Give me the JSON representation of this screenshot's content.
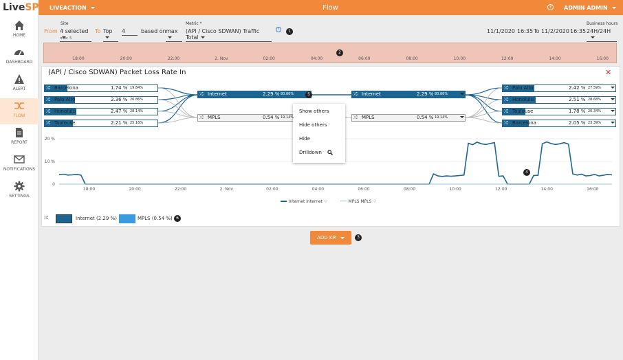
{
  "app": {
    "logo_a": "Live",
    "logo_b": "SP",
    "title": "Flow",
    "project": "LIVEACTION",
    "user": "ADMIN ADMIN"
  },
  "sidebar": {
    "items": [
      {
        "label": "HOME",
        "icon": "home-icon"
      },
      {
        "label": "DASHBOARD",
        "icon": "speedometer-icon"
      },
      {
        "label": "ALERT",
        "icon": "warning-icon"
      },
      {
        "label": "FLOW",
        "icon": "flow-icon"
      },
      {
        "label": "REPORT",
        "icon": "document-icon"
      },
      {
        "label": "NOTIFICATIONS",
        "icon": "mail-icon"
      },
      {
        "label": "SETTINGS",
        "icon": "gear-icon"
      }
    ],
    "active": "FLOW"
  },
  "filters": {
    "site_label": "Site",
    "from_label": "From",
    "site_value": "4 selected",
    "max_hint": "max: 5",
    "to_label": "To",
    "top_value": "Top",
    "top_count": "4",
    "based_on_label": "based on",
    "based_on_value": "max",
    "metric_label": "Metric *",
    "metric_value": "(API / Cisco SDWAN) Traffic Total",
    "date_from": "11/1/2020",
    "time_from": "16:35",
    "date_to_label": "To 11/2/2020",
    "time_to": "16:35",
    "business_hours_label": "Business hours",
    "business_hours_value": "24H/24H",
    "callout_1": "1",
    "callout_2": "2",
    "callout_3": "3",
    "callout_4": "4",
    "callout_5": "5",
    "callout_6": "6"
  },
  "timeline": {
    "ticks": [
      "18:00",
      "20:00",
      "22:00",
      "2. Nov",
      "02:00",
      "04:00",
      "06:00",
      "08:00",
      "10:00",
      "12:00",
      "14:00",
      "16:00"
    ]
  },
  "panel": {
    "title": "(API / Cisco SDWAN) Packet Loss Rate In",
    "left_sites": [
      {
        "name": "Barcelona",
        "pct": "1.74 %",
        "share": "19.84%",
        "fill": 0.2
      },
      {
        "name": "Palo Alto",
        "pct": "2.36 %",
        "share": "26.86%",
        "fill": 0.27
      },
      {
        "name": "Honolulu",
        "pct": "2.47 %",
        "share": "28.14%",
        "fill": 0.28
      },
      {
        "name": "Toulouse",
        "pct": "2.21 %",
        "share": "25.16%",
        "fill": 0.25
      }
    ],
    "mid_left": [
      {
        "name": "Internet",
        "pct": "2.29 %",
        "share": "80.86%"
      },
      {
        "name": "MPLS",
        "pct": "0.54 %",
        "share": "19.14%"
      }
    ],
    "mid_right": [
      {
        "name": "Internet",
        "pct": "2.29 %",
        "share": "80.86%"
      },
      {
        "name": "MPLS",
        "pct": "0.54 %",
        "share": "19.14%"
      }
    ],
    "right_sites": [
      {
        "name": "Palo Alto",
        "pct": "2.42 %",
        "share": "27.59%",
        "fill": 0.28
      },
      {
        "name": "Honolulu",
        "pct": "2.51 %",
        "share": "28.68%",
        "fill": 0.29
      },
      {
        "name": "Toulouse",
        "pct": "1.78 %",
        "share": "20.34%",
        "fill": 0.2
      },
      {
        "name": "Barcelona",
        "pct": "2.05 %",
        "share": "23.39%",
        "fill": 0.23
      }
    ],
    "context_menu": [
      "Show others",
      "Hide others",
      "Hide",
      "Drilldown"
    ],
    "legend_bottom": [
      {
        "label": "Internet (2.29 %)",
        "color": "#1d6591"
      },
      {
        "label": "MPLS (0.54 %)",
        "color": "#3a9be0"
      }
    ],
    "chart_legend": [
      "Internet Internet",
      "MPLS MPLS"
    ]
  },
  "chart_data": {
    "type": "line",
    "y_ticks": [
      "20 %",
      "10 %",
      "0"
    ],
    "ylim": [
      0,
      20
    ],
    "x_ticks": [
      "18:00",
      "20:00",
      "22:00",
      "2. Nov",
      "02:00",
      "04:00",
      "06:00",
      "08:00",
      "10:00",
      "12:00",
      "14:00",
      "16:00"
    ],
    "series": [
      {
        "name": "Internet Internet",
        "color": "#1d6591",
        "x": [
          0,
          0.2,
          0.4,
          0.6,
          0.8,
          1,
          1.2,
          1.5,
          2,
          4,
          6,
          8,
          10,
          12,
          14,
          16,
          17,
          17.2,
          17.4,
          17.6,
          17.8,
          18,
          18.2,
          18.4,
          18.6,
          18.8,
          19,
          19.2,
          19.4,
          19.6,
          19.8,
          20,
          20.2,
          20.4,
          20.6,
          20.8,
          21,
          21.2,
          21.4,
          21.6,
          21.8,
          22,
          22.2,
          22.4,
          22.6,
          22.8,
          23,
          23.2,
          23.4,
          23.6,
          23.8,
          24,
          24.2,
          24.4,
          24.6,
          24.8,
          25,
          25.2,
          25.4
        ],
        "y": [
          4.2,
          4.4,
          4.0,
          4.1,
          4.3,
          4.0,
          0,
          0,
          0,
          0,
          0,
          0,
          0,
          0,
          0,
          0,
          0,
          4.5,
          3.6,
          3.4,
          3.6,
          3.5,
          3.6,
          3.8,
          4.0,
          18.0,
          17.4,
          18.5,
          17.8,
          17.5,
          17.9,
          18.3,
          3.5,
          3.6,
          0,
          0,
          0,
          0,
          0,
          0,
          3.8,
          3.9,
          17.8,
          18.6,
          17.9,
          17.5,
          17.8,
          18.3,
          17.6,
          4.5,
          4.0,
          4.4,
          3.6,
          3.8,
          4.3,
          3.6,
          3.9,
          4.3,
          4.1
        ]
      },
      {
        "name": "MPLS MPLS",
        "color": "#8fc4e8",
        "x": [
          0,
          25.4
        ],
        "y": [
          0,
          0
        ]
      }
    ]
  }
}
